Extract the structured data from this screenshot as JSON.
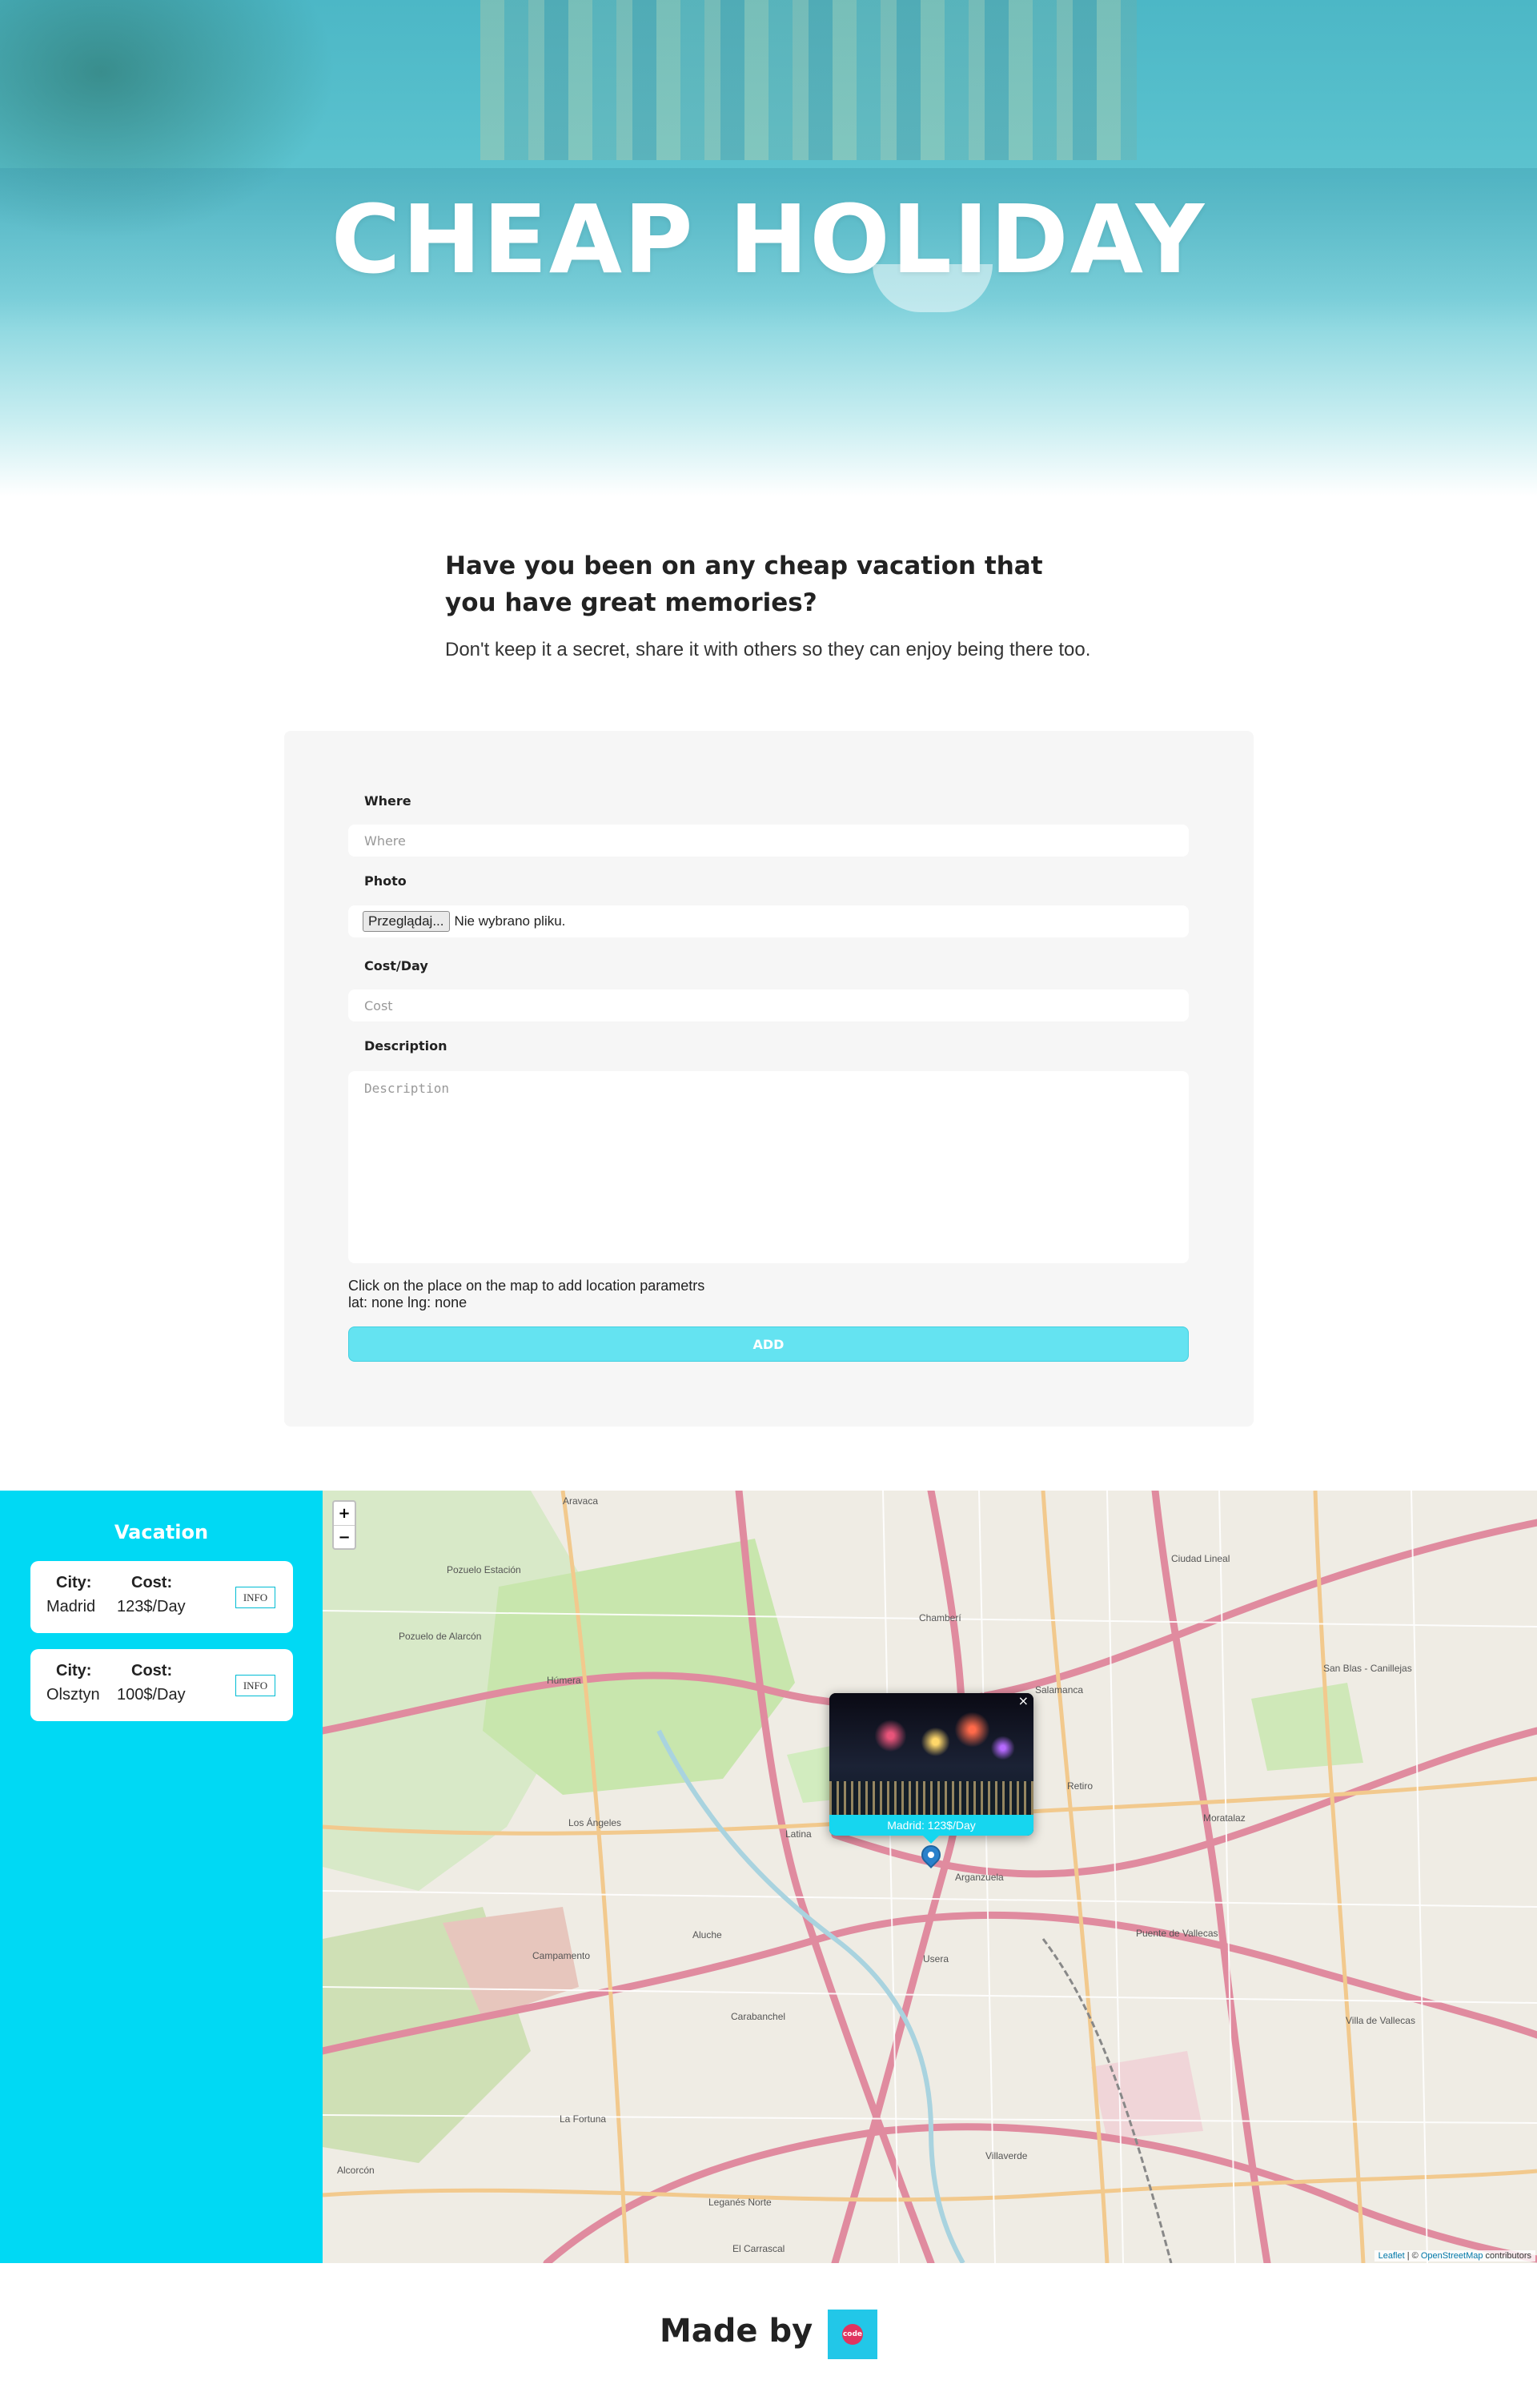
{
  "hero": {
    "title": "CHEAP HOLIDAY"
  },
  "intro": {
    "heading": "Have you been on any cheap vacation that you have great memories?",
    "text": "Don't keep it a secret, share it with others so they can enjoy being there too."
  },
  "form": {
    "where_label": "Where",
    "where_placeholder": "Where",
    "photo_label": "Photo",
    "file_button": "Przeglądaj...",
    "file_status": "Nie wybrano pliku.",
    "cost_label": "Cost/Day",
    "cost_placeholder": "Cost",
    "description_label": "Description",
    "description_placeholder": "Description",
    "hint": "Click on the place on the map to add location parametrs",
    "coords": "lat: none lng: none",
    "add_button": "ADD"
  },
  "sidebar": {
    "title": "Vacation",
    "city_key": "City:",
    "cost_key": "Cost:",
    "info_label": "INFO",
    "items": [
      {
        "city": "Madrid",
        "cost": "123$/Day"
      },
      {
        "city": "Olsztyn",
        "cost": "100$/Day"
      }
    ]
  },
  "map": {
    "zoom_in": "+",
    "zoom_out": "−",
    "popup_caption": "Madrid: 123$/Day",
    "popup_close": "×",
    "attribution_leaflet": "Leaflet",
    "attribution_sep": " | © ",
    "attribution_osm": "OpenStreetMap",
    "attribution_tail": " contributors",
    "labels": [
      "Aravaca",
      "Pozuelo Estación",
      "Pozuelo de Alarcón",
      "Húmera",
      "Chamberí",
      "Ciudad Lineal",
      "Salamanca",
      "Retiro",
      "Moratalaz",
      "Arganzuela",
      "Usera",
      "Carabanchel",
      "Aluche",
      "Latina",
      "Los Ángeles",
      "Puente de Vallecas",
      "Villaverde",
      "Villa de Vallecas",
      "Alcorcón",
      "Leganés Norte",
      "San Blas - Canillejas",
      "Campamento",
      "La Fortuna",
      "El Carrascal"
    ]
  },
  "footer": {
    "made_by": "Made by",
    "logo_text": "code"
  }
}
